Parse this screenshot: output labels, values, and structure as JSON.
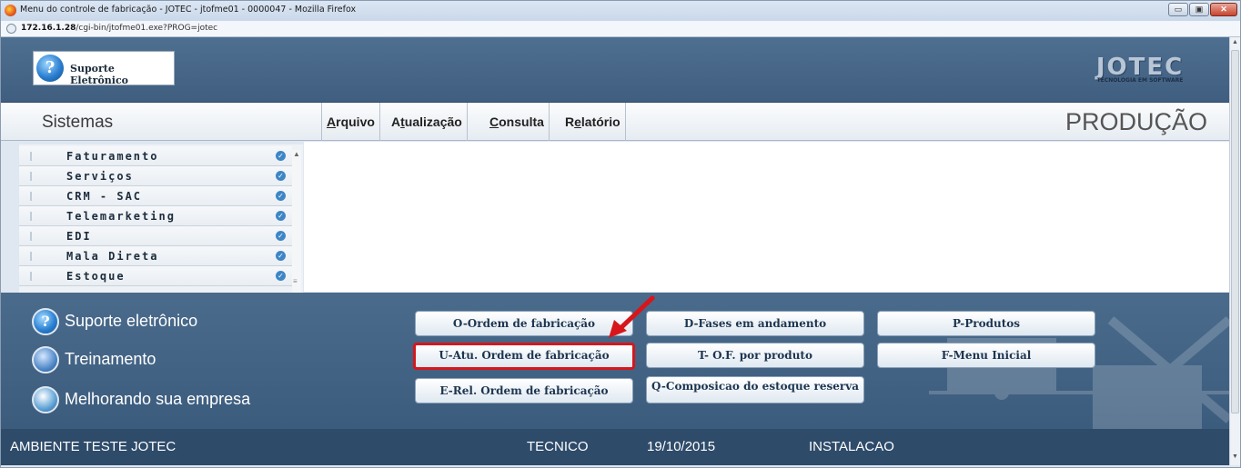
{
  "window": {
    "title": "Menu do controle de fabricação - JOTEC - jtofme01 - 0000047 - Mozilla Firefox",
    "controls": {
      "minimize": "▭",
      "maximize": "▣",
      "close": "✕"
    }
  },
  "address": {
    "host": "172.16.1.28",
    "path": "/cgi-bin/jtofme01.exe?PROG=jotec"
  },
  "header": {
    "suporte_label": "Suporte Eletrônico",
    "logo_text": "JOTEC",
    "logo_tagline": "TECNOLOGIA EM SOFTWARE"
  },
  "menubar": {
    "sistemas": "Sistemas",
    "items": [
      {
        "pre": "",
        "key": "A",
        "post": "rquivo"
      },
      {
        "pre": "A",
        "key": "t",
        "post": "ualização"
      },
      {
        "pre": "",
        "key": "C",
        "post": "onsulta"
      },
      {
        "pre": "R",
        "key": "e",
        "post": "latório"
      }
    ],
    "module": "PRODUÇÃO"
  },
  "sidebar": {
    "items": [
      "Faturamento",
      "Serviços",
      "CRM - SAC",
      "Telemarketing",
      "EDI",
      "Mala Direta",
      "Estoque"
    ]
  },
  "links": {
    "suporte": "Suporte eletrônico",
    "treinamento": "Treinamento",
    "melhorando": "Melhorando sua empresa"
  },
  "buttons": {
    "o": "O-Ordem de fabricação",
    "u": "U-Atu. Ordem de fabricação",
    "e": "E-Rel. Ordem de fabricação",
    "d": "D-Fases em andamento",
    "t": "T- O.F. por produto",
    "q": "Q-Composicao do estoque reserva",
    "p": "P-Produtos",
    "f": "F-Menu Inicial"
  },
  "status": {
    "ambiente": "AMBIENTE TESTE JOTEC",
    "user": "TECNICO",
    "date": "19/10/2015",
    "instalacao": "INSTALACAO"
  },
  "colors": {
    "highlight": "#d7161b",
    "header_blue": "#3f5e80",
    "status_blue": "#2e4b6a"
  }
}
